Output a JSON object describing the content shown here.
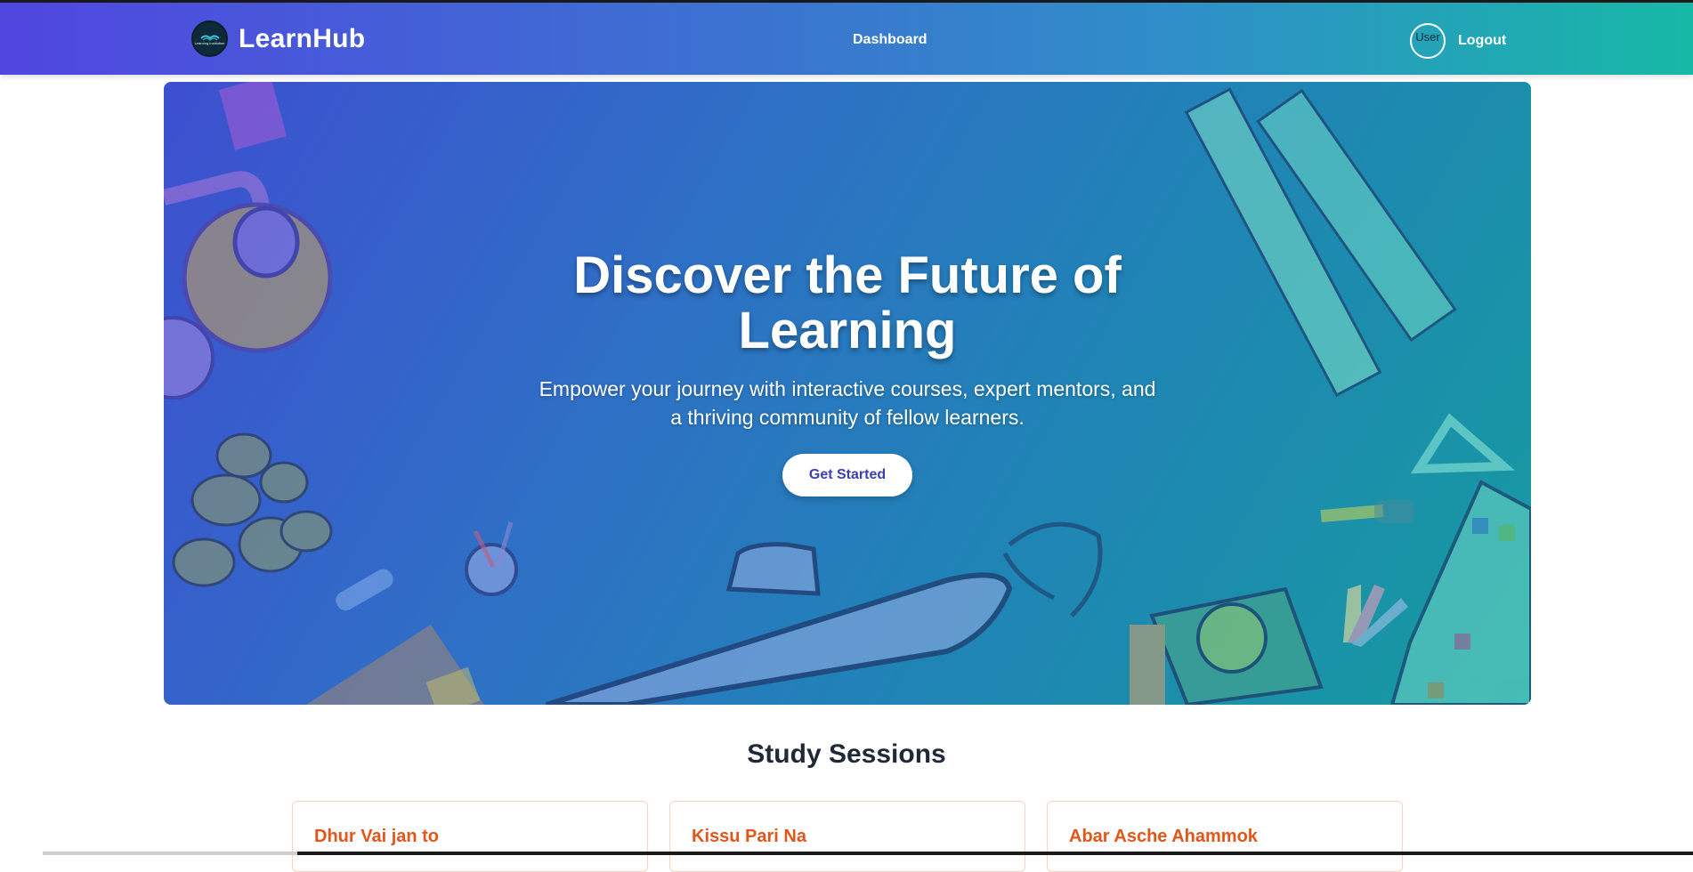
{
  "navbar": {
    "brand": "LearnHub",
    "logo_text": "Learning Institution",
    "links": [
      "Dashboard"
    ],
    "avatar_alt": "User",
    "logout_label": "Logout"
  },
  "hero": {
    "title": "Discover the Future of Learning",
    "subtitle": "Empower your journey with interactive courses, expert mentors, and a thriving community of fellow learners.",
    "cta_label": "Get Started"
  },
  "sessions": {
    "title": "Study Sessions",
    "cards": [
      {
        "title": "Dhur Vai jan to"
      },
      {
        "title": "Kissu Pari Na"
      },
      {
        "title": "Abar Asche Ahammok"
      }
    ]
  },
  "colors": {
    "nav_gradient_start": "#5046e0",
    "nav_gradient_end": "#17b8a6",
    "card_title": "#e2561a",
    "cta_text": "#3b3fb0"
  }
}
